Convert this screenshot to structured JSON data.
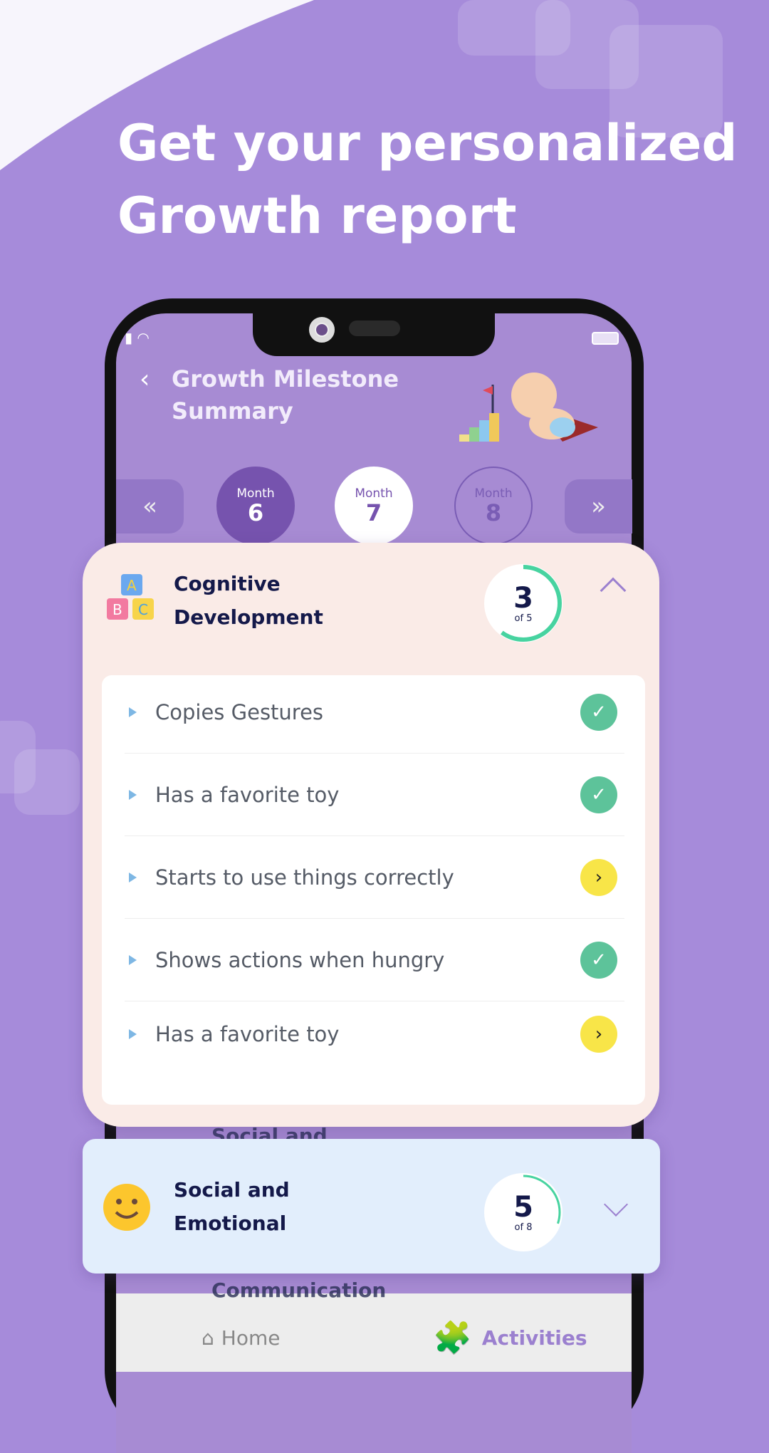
{
  "headline": {
    "line1": "Get your personalized",
    "line2": "Growth report"
  },
  "app": {
    "title_line1": "Growth Milestone",
    "title_line2": "Summary",
    "months": [
      {
        "label": "Month",
        "number": "6",
        "state": "past"
      },
      {
        "label": "Month",
        "number": "7",
        "state": "selected"
      },
      {
        "label": "Month",
        "number": "8",
        "state": "upcoming"
      }
    ]
  },
  "cognitive": {
    "title_line1": "Cognitive",
    "title_line2": "Development",
    "score": "3",
    "total": "of 5",
    "progress": 0.6,
    "items": [
      {
        "label": "Copies Gestures",
        "status": "done"
      },
      {
        "label": "Has a favorite toy",
        "status": "done"
      },
      {
        "label": "Starts to use things correctly",
        "status": "pending"
      },
      {
        "label": "Shows actions when hungry",
        "status": "done"
      },
      {
        "label": "Has a favorite toy",
        "status": "pending"
      }
    ]
  },
  "social": {
    "title_line1": "Social and",
    "title_line2": "Emotional",
    "score": "5",
    "total": "of 8",
    "progress": 0.3
  },
  "behind": {
    "social_peek": "Social and",
    "communication_peek": "Communication"
  },
  "nav": {
    "home": "Home",
    "activities": "Activities"
  },
  "colors": {
    "background": "#A68BDA",
    "done": "#5DC39A",
    "pending": "#F8E548",
    "ring": "#47D3A0"
  }
}
